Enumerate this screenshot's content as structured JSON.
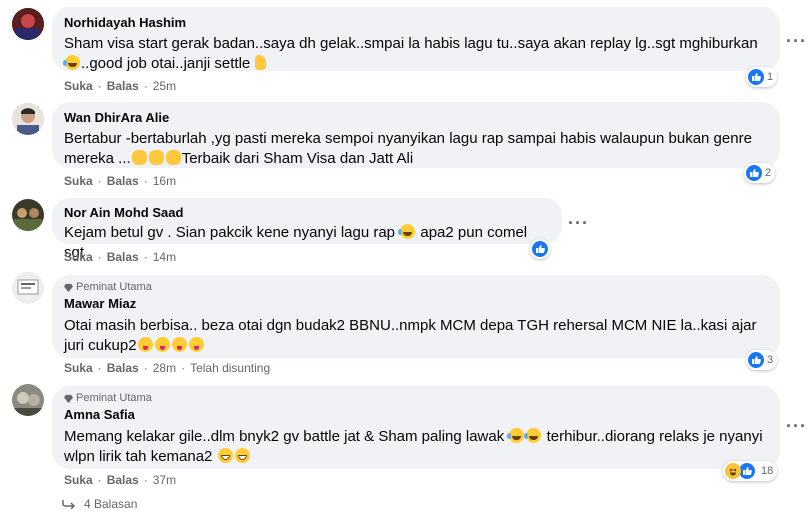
{
  "comments": [
    {
      "name": "Norhidayah Hashim",
      "text_lines": [
        "Sham visa start gerak badan..saya dh gelak..smpai la habis lagu tu..saya akan replay lg..sgt mghiburkan",
        "..good job otai..janji settle"
      ],
      "like": "Suka",
      "reply": "Balas",
      "time": "25m",
      "reaction_count": "1",
      "avatar_color": "#7a2a2a"
    },
    {
      "name": "Wan DhirAra Alie",
      "text_lines": [
        "Bertabur -bertaburlah ,yg pasti mereka sempoi nyanyikan lagu rap sampai habis walaupun bukan genre",
        "mereka ...",
        "Terbaik dari Sham Visa dan Jatt Ali"
      ],
      "like": "Suka",
      "reply": "Balas",
      "time": "16m",
      "reaction_count": "2",
      "avatar_color": "#c9a98a"
    },
    {
      "name": "Nor Ain Mohd Saad",
      "text_lines": [
        "Kejam betul gv . Sian pakcik kene nyanyi lagu rap",
        "apa2 pun comel sgt"
      ],
      "like": "Suka",
      "reply": "Balas",
      "time": "14m",
      "reaction_count": "",
      "avatar_color": "#3b3a2a"
    },
    {
      "badge": "Peminat Utama",
      "name": "Mawar Miaz",
      "text_lines": [
        "Otai masih berbisa.. beza otai dgn budak2 BBNU..nmpk MCM depa TGH rehersal MCM NIE la..kasi ajar",
        "juri cukup2"
      ],
      "like": "Suka",
      "reply": "Balas",
      "time": "28m",
      "edited": "Telah disunting",
      "reaction_count": "3",
      "avatar_color": "#d8d8d8"
    },
    {
      "badge": "Peminat Utama",
      "name": "Amna Safia",
      "text_lines": [
        "Memang kelakar gile..dlm bnyk2 gv battle jat & Sham paling lawak",
        "terhibur..diorang relaks je nyanyi",
        "wlpn lirik tah kemana2"
      ],
      "like": "Suka",
      "reply": "Balas",
      "time": "37m",
      "reaction_count": "18",
      "avatar_color": "#8a8a80"
    }
  ],
  "replies_label": "4 Balasan",
  "colors": {
    "like_blue": "#1877f2",
    "bubble": "#f0f2f5",
    "meta": "#65676b"
  }
}
